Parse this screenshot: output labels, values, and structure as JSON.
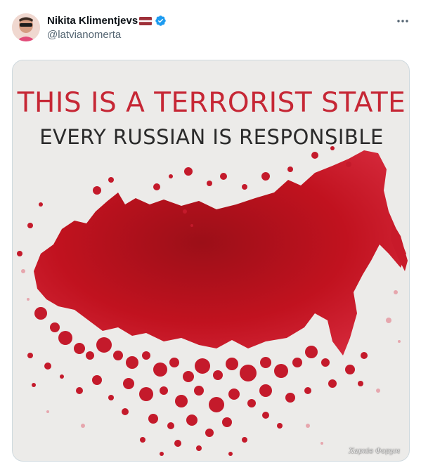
{
  "author": {
    "display_name": "Nikita Klimentjevs",
    "handle": "@latvianomerta",
    "flag": "latvia-flag",
    "verified": true
  },
  "post": {
    "more_icon": "more-horizontal-icon"
  },
  "media": {
    "headline": "THIS IS A TERRORIST STATE",
    "subheadline": "EVERY RUSSIAN IS RESPONSIBLE",
    "image_description_icon": "russia-map-blood-splatter",
    "headline_color": "#c62735",
    "map_color": "#b4141f",
    "background_color": "#ecebe9"
  },
  "watermark": "Харків Форум"
}
